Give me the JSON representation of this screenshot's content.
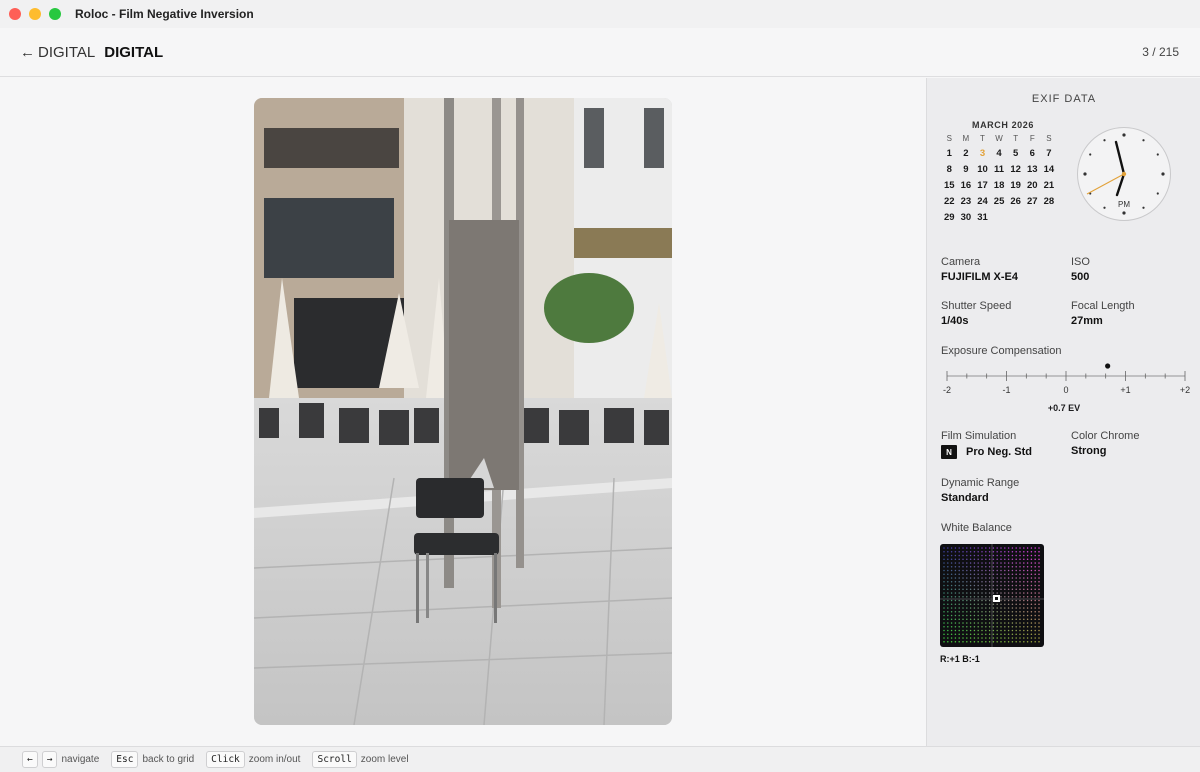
{
  "window": {
    "title": "Roloc - Film Negative Inversion"
  },
  "header": {
    "back_label": "DIGITAL",
    "title": "DIGITAL",
    "counter": "3 / 215"
  },
  "photo": {
    "alt": "Outdoor cafe plaza with a black chair beside metal poles"
  },
  "exif": {
    "section_title": "EXIF DATA",
    "calendar": {
      "month": "MARCH 2026",
      "weekdays": [
        "S",
        "M",
        "T",
        "W",
        "T",
        "F",
        "S"
      ],
      "selected_day": "3"
    },
    "clock": {
      "meridiem": "PM"
    },
    "camera": {
      "label": "Camera",
      "value": "FUJIFILM X-E4"
    },
    "iso": {
      "label": "ISO",
      "value": "500"
    },
    "shutter": {
      "label": "Shutter Speed",
      "value": "1/40s"
    },
    "focal": {
      "label": "Focal Length",
      "value": "27mm"
    },
    "exposure": {
      "label": "Exposure Compensation",
      "value_text": "+0.7 EV",
      "value": 0.7,
      "ticks": [
        "-2",
        "-1",
        "0",
        "+1",
        "+2"
      ]
    },
    "film_sim": {
      "label": "Film Simulation",
      "value": "Pro Neg. Std",
      "badge": "N"
    },
    "color_chrome": {
      "label": "Color Chrome",
      "value": "Strong"
    },
    "dynamic_range": {
      "label": "Dynamic Range",
      "value": "Standard"
    },
    "white_balance": {
      "label": "White Balance",
      "value": "R:+1 B:-1"
    }
  },
  "footer": {
    "left_key": "←",
    "right_key": "→",
    "navigate": "navigate",
    "esc_key": "Esc",
    "esc_label": "back to grid",
    "click_key": "Click",
    "click_label": "zoom in/out",
    "scroll_key": "Scroll",
    "scroll_label": "zoom level"
  },
  "colors": {
    "accent": "#e2a23a",
    "wb_panel": "#0f0f12"
  }
}
